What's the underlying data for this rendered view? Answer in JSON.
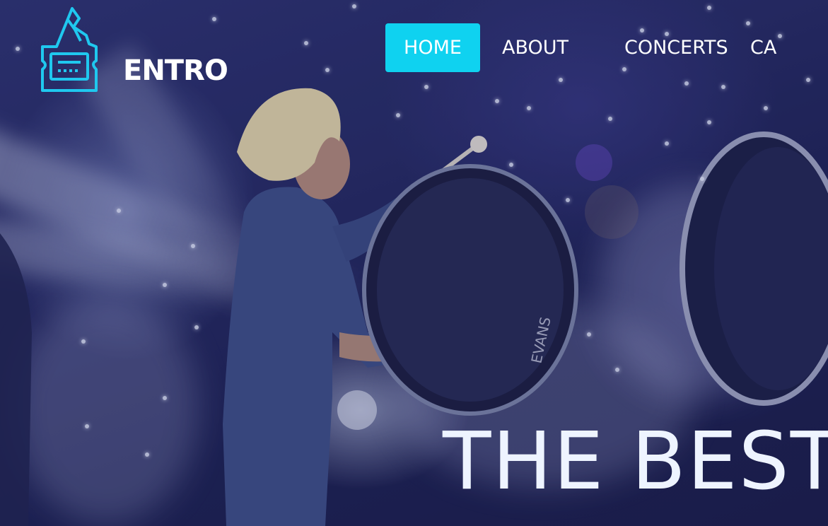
{
  "brand": {
    "name": "ENTRO",
    "icon": "ticket-icon",
    "accent_color": "#0fd2f0"
  },
  "nav": {
    "items": [
      {
        "label": "HOME",
        "active": true
      },
      {
        "label": "ABOUT",
        "active": false
      },
      {
        "label": "CONCERTS",
        "active": false
      },
      {
        "label": "CA",
        "active": false
      }
    ]
  },
  "hero": {
    "title": "THE BEST",
    "image": "drummer-on-stage-photo"
  }
}
